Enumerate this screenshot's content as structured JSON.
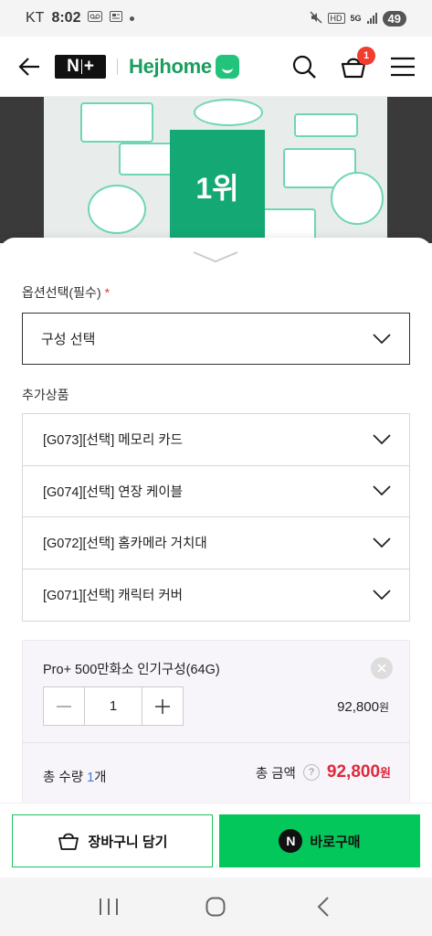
{
  "status_bar": {
    "carrier": "KT",
    "time": "8:02",
    "network": "5G",
    "battery": "49"
  },
  "header": {
    "nplus_logo": "N+",
    "brand": "Hejhome",
    "cart_count": "1"
  },
  "product_image": {
    "rank_text": "1위"
  },
  "options": {
    "required_label": "옵션선택(필수)",
    "required_mark": "*",
    "main_select": "구성 선택",
    "extra_label": "추가상품",
    "extra_items": [
      {
        "label": "[G073][선택] 메모리 카드"
      },
      {
        "label": "[G074][선택] 연장 케이블"
      },
      {
        "label": "[G072][선택] 홈카메라 거치대"
      },
      {
        "label": "[G071][선택] 캐릭터 커버"
      }
    ]
  },
  "selected": {
    "name": "Pro+ 500만화소 인기구성(64G)",
    "quantity": "1",
    "price": "92,800",
    "currency": "원",
    "total_qty_label": "총 수량",
    "total_qty": "1",
    "total_qty_unit": "개",
    "total_amount_label": "총 금액",
    "help_mark": "?",
    "total_amount": "92,800"
  },
  "actions": {
    "cart_button": "장바구니 담기",
    "buy_button": "바로구매",
    "buy_logo": "N"
  },
  "colors": {
    "brand_green": "#1a9d5f",
    "naver_green": "#03c75a",
    "price_red": "#e0283b",
    "badge_red": "#f33c2e"
  }
}
